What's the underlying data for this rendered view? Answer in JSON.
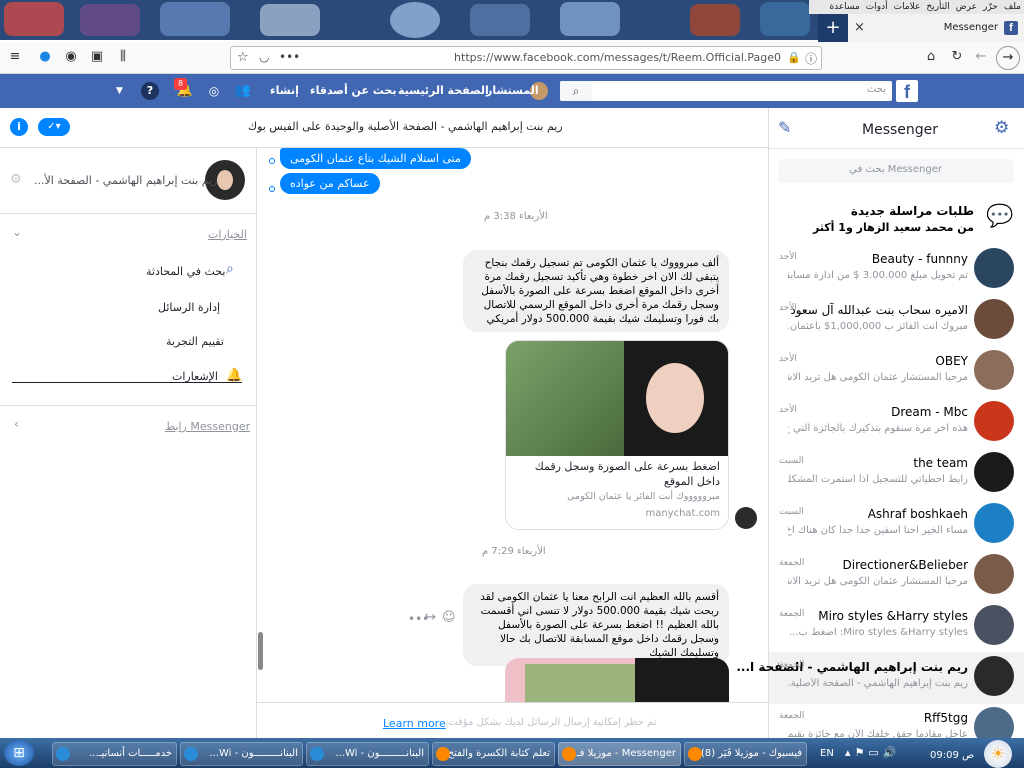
{
  "browser": {
    "menu": [
      "ملف",
      "حرّر",
      "عرض",
      "التأريخ",
      "علامات",
      "أدوات",
      "مساعدة"
    ],
    "tab_title": "Messenger",
    "url": "https://www.facebook.com/messages/t/Reem.Official.Page0",
    "url_more": "•••",
    "new_tab": "+",
    "close": "×"
  },
  "fb": {
    "logo": "f",
    "search_placeholder": "بحث",
    "user_name": "المستشار",
    "home": "الصفحة الرئيسية",
    "find_friends": "بحث عن أصدقاء",
    "create": "إنشاء",
    "notif_badge": "8"
  },
  "messenger": {
    "title": "Messenger",
    "search_placeholder": "بحث في Messenger",
    "requests_title": "طلبات مراسلة جديدة",
    "requests_sub": "من محمد سعيد الزهار و1 أكثر",
    "conversations": [
      {
        "name": "Beauty - funnny",
        "preview": "تم تحويل مبلغ 3.00.000 $ من ادارة مسابقة...",
        "time": "الأحد",
        "color": "#2b4760"
      },
      {
        "name": "الاميره سحاب بنت عبدالله آل سعود",
        "preview": "مبروك أنت الفائز ب 1,000,000$ باعثمان...",
        "time": "الأحد",
        "color": "#6b4b3a"
      },
      {
        "name": "OBEY",
        "preview": "مرحباً المستشار عثمان الكومى هل تريد الاشت...",
        "time": "الأحد",
        "color": "#8a6d5a"
      },
      {
        "name": "Dream - Mbc",
        "preview": "هذه اخر مرة سنقوم بتذكيرك بالجائزة التي ح...",
        "time": "الأحد",
        "color": "#c9361a"
      },
      {
        "name": "the team",
        "preview": "رابط احطياتي للتسجيل اذا استمرت المشكلة ا...",
        "time": "السبت",
        "color": "#1a1a1a"
      },
      {
        "name": "Ashraf boshkaeh",
        "preview": "مساء الخير احنا أسفين جدا جدا كان هناك أخ...",
        "time": "السبت",
        "color": "#1d7fc4"
      },
      {
        "name": "Directioner&Belieber",
        "preview": "مرحباً المستشار عثمان الكومى هل تريد الاشت...",
        "time": "الجمعة",
        "color": "#7a5a48"
      },
      {
        "name": "Miro styles &Harry styles",
        "preview": "Miro styles &Harry styles: اضغط ب...",
        "time": "الجمعة",
        "color": "#4a5160"
      },
      {
        "name": "ريم بنت إبراهيم الهاشمي - الصفحة ا...",
        "preview": "ريم بنت إبراهيم الهاشمي - الصفحة الأصلية...",
        "time": "الجمعة",
        "color": "#2a2a2a"
      },
      {
        "name": "Rff5tgg",
        "preview": "عاجل مقادماً حقق خلفك الآن مع جائزة بقيمة...",
        "time": "الجمعة",
        "color": "#4d6a88"
      }
    ]
  },
  "chat": {
    "header_title": "ريم بنت إبراهيم الهاشمي - الصفحة الأصلية والوحيدة على الفيس بوك",
    "sent1": "متى استلام الشيك بتاع عثمان الكومى",
    "sent2": "عساكم من عواده",
    "time1": "الأربعاء 3:38 م",
    "msg1": "ألف مبروووك يا عثمان الكومى تم تسجيل رقمك بنجاح يتبقى لك الان اخر خطوة وهي تأكيد تسجيل رقمك مرة أخرى داخل الموقع اضغط بسرعة على الصورة بالأسفل وسجل رقمك مرة أخرى داخل الموقع الرسمي للاتصال بك فورا وتسليمك شيك بقيمة 500.000 دولار أمريكي",
    "card_title": "اضغط بسرعة على الصورة وسجل رقمك داخل الموقع",
    "card_sub": "مبروووووك أنت الفائز يا عثمان الكومى",
    "card_domain": "manychat.com",
    "time2": "الأربعاء 7:29 م",
    "msg2": "أقسم بالله العظيم انت الرابح معنا يا عثمان الكومى لقد ربحت شيك بقيمة 500.000 دولار لا تنسى اني أقسمت بالله العظيم !! اضغط بسرعة على الصورة بالأسفل وسجل رقمك داخل موقع المسابقة للاتصال بك حالا وتسليمك الشيك",
    "footer_note": "تم حظر إمكانية إرسال الرسائل لديك بشكل مؤقت.",
    "learn_more": "Learn more"
  },
  "details": {
    "name": "ريم بنت إبراهيم الهاشمي - الصفحة الأ...",
    "options_title": "الخيارات",
    "search_conv": "بحث في المحادثة",
    "manage": "إدارة الرسائل",
    "rate": "تقييم التجربة",
    "notifications": "الإشعارات",
    "messenger_link": "رابط Messenger"
  },
  "taskbar": {
    "items": [
      "خدمـــــات أنسانيـ...",
      "البنانـــــــــون - Wi...",
      "البنانـــــــــون - Wi...",
      "تعلم كتابة الكسرة والفتح...",
      "Messenger - موزيلا فـ...",
      "فيسبوك - موزيلا فَيَر (8)"
    ],
    "lang": "EN",
    "clock": "ص 09:09"
  }
}
